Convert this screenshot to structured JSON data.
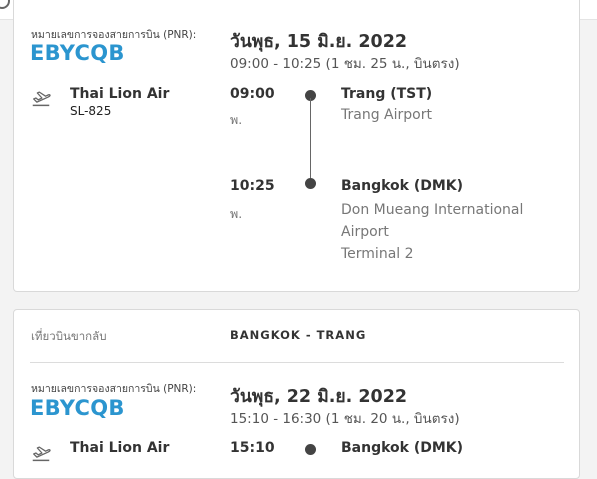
{
  "outbound": {
    "pnr_label": "หมายเลขการจองสายการบิน (PNR):",
    "pnr_code": "EBYCQB",
    "date": "วันพุธ, 15 มิ.ย. 2022",
    "summary": "09:00 - 10:25 (1 ชม. 25 น., บินตรง)",
    "airline": "Thai Lion Air",
    "flight_no": "SL-825",
    "depart": {
      "time": "09:00",
      "period": "พ.",
      "city": "Trang (TST)",
      "airport": "Trang Airport"
    },
    "arrive": {
      "time": "10:25",
      "period": "พ.",
      "city": "Bangkok (DMK)",
      "airport_line1": "Don Mueang International",
      "airport_line2": "Airport",
      "terminal": "Terminal 2"
    }
  },
  "return": {
    "section_label": "เที่ยวบินขากลับ",
    "route": "BANGKOK - TRANG",
    "pnr_label": "หมายเลขการจองสายการบิน (PNR):",
    "pnr_code": "EBYCQB",
    "date": "วันพุธ, 22 มิ.ย. 2022",
    "summary": "15:10 - 16:30 (1 ชม. 20 น., บินตรง)",
    "airline": "Thai Lion Air",
    "depart": {
      "time": "15:10",
      "city": "Bangkok (DMK)"
    }
  },
  "icons": {
    "airline_icon": "airplane-icon"
  },
  "colors": {
    "accent": "#2b95cf",
    "background": "#f3f3f3"
  }
}
